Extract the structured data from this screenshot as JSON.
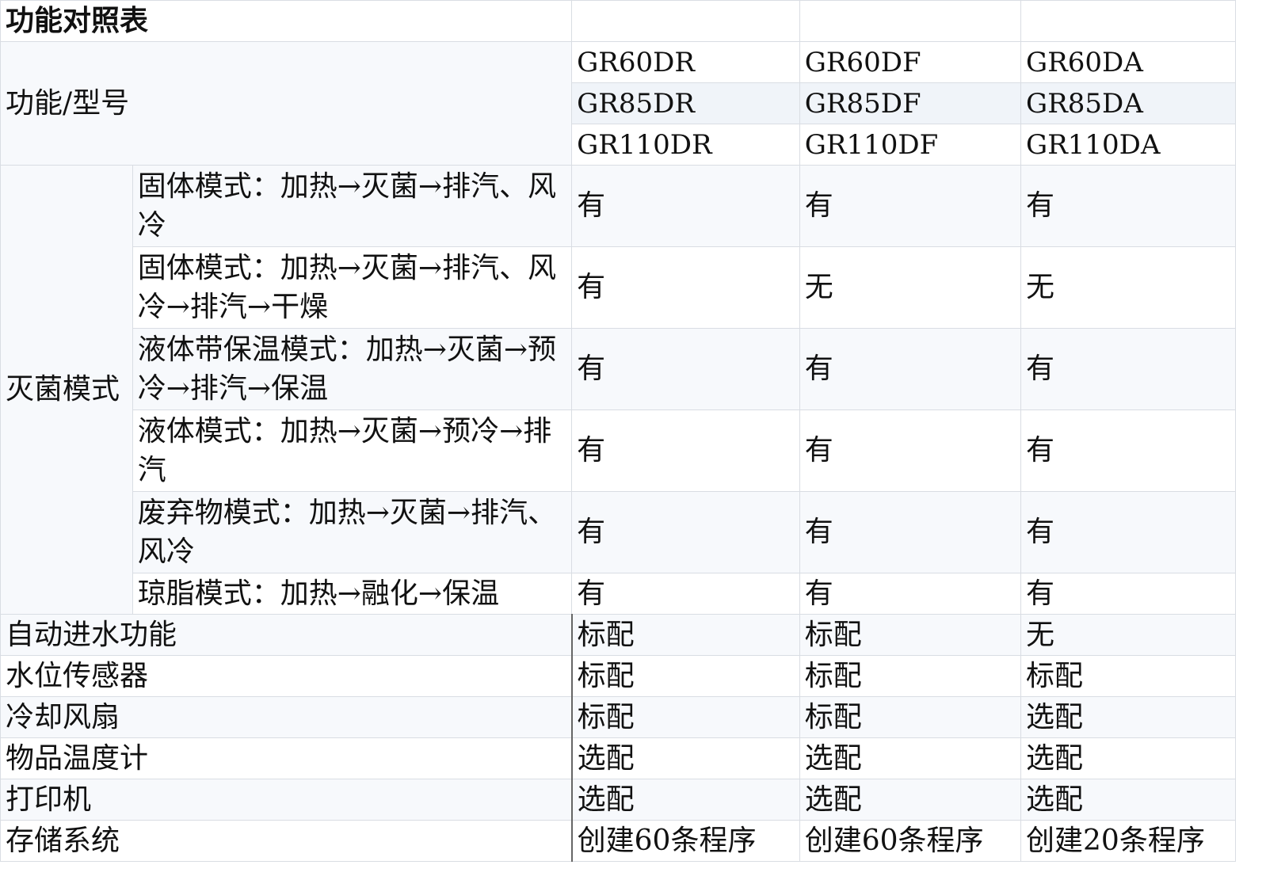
{
  "title": "功能对照表",
  "header_label": "功能/型号",
  "models": [
    [
      "GR60DR",
      "GR60DF",
      "GR60DA"
    ],
    [
      "GR85DR",
      "GR85DF",
      "GR85DA"
    ],
    [
      "GR110DR",
      "GR110DF",
      "GR110DA"
    ]
  ],
  "sterilization": {
    "label": "灭菌模式",
    "rows": [
      {
        "mode": "固体模式：加热→灭菌→排汽、风冷",
        "values": [
          "有",
          "有",
          "有"
        ]
      },
      {
        "mode": "固体模式：加热→灭菌→排汽、风冷→排汽→干燥",
        "values": [
          "有",
          "无",
          "无"
        ]
      },
      {
        "mode": "液体带保温模式：加热→灭菌→预冷→排汽→保温",
        "values": [
          "有",
          "有",
          "有"
        ]
      },
      {
        "mode": "液体模式：加热→灭菌→预冷→排汽",
        "values": [
          "有",
          "有",
          "有"
        ]
      },
      {
        "mode": "废弃物模式：加热→灭菌→排汽、风冷",
        "values": [
          "有",
          "有",
          "有"
        ]
      },
      {
        "mode": "琼脂模式：加热→融化→保温",
        "values": [
          "有",
          "有",
          "有"
        ]
      }
    ]
  },
  "features": [
    {
      "name": "自动进水功能",
      "values": [
        "标配",
        "标配",
        "无"
      ]
    },
    {
      "name": "水位传感器",
      "values": [
        "标配",
        "标配",
        "标配"
      ]
    },
    {
      "name": "冷却风扇",
      "values": [
        "标配",
        "标配",
        "选配"
      ]
    },
    {
      "name": "物品温度计",
      "values": [
        "选配",
        "选配",
        "选配"
      ]
    },
    {
      "name": "打印机",
      "values": [
        "选配",
        "选配",
        "选配"
      ]
    },
    {
      "name": "存储系统",
      "values": [
        "创建60条程序",
        "创建60条程序",
        "创建20条程序"
      ]
    }
  ]
}
